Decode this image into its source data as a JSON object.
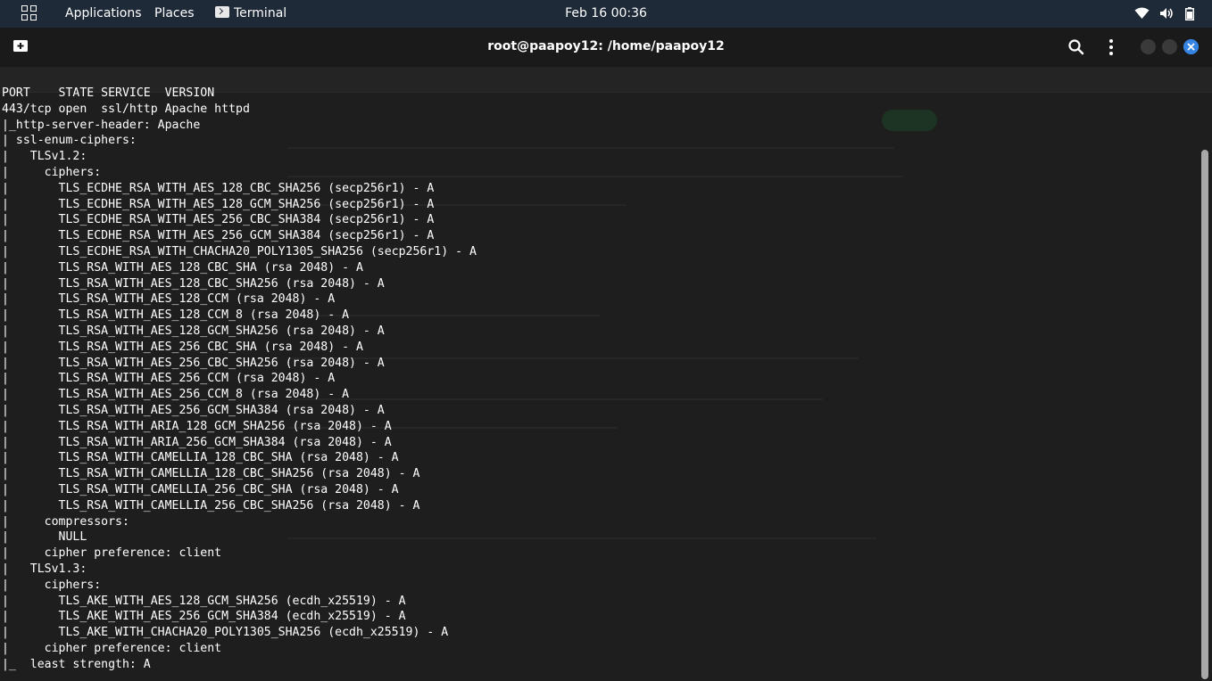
{
  "topbar": {
    "applications": "Applications",
    "places": "Places",
    "terminal": "Terminal",
    "datetime": "Feb 16  00:36"
  },
  "window": {
    "title": "root@paapoy12: /home/paapoy12"
  },
  "terminal": {
    "lines": [
      "PORT    STATE SERVICE  VERSION",
      "443/tcp open  ssl/http Apache httpd",
      "|_http-server-header: Apache",
      "| ssl-enum-ciphers:",
      "|   TLSv1.2:",
      "|     ciphers:",
      "|       TLS_ECDHE_RSA_WITH_AES_128_CBC_SHA256 (secp256r1) - A",
      "|       TLS_ECDHE_RSA_WITH_AES_128_GCM_SHA256 (secp256r1) - A",
      "|       TLS_ECDHE_RSA_WITH_AES_256_CBC_SHA384 (secp256r1) - A",
      "|       TLS_ECDHE_RSA_WITH_AES_256_GCM_SHA384 (secp256r1) - A",
      "|       TLS_ECDHE_RSA_WITH_CHACHA20_POLY1305_SHA256 (secp256r1) - A",
      "|       TLS_RSA_WITH_AES_128_CBC_SHA (rsa 2048) - A",
      "|       TLS_RSA_WITH_AES_128_CBC_SHA256 (rsa 2048) - A",
      "|       TLS_RSA_WITH_AES_128_CCM (rsa 2048) - A",
      "|       TLS_RSA_WITH_AES_128_CCM_8 (rsa 2048) - A",
      "|       TLS_RSA_WITH_AES_128_GCM_SHA256 (rsa 2048) - A",
      "|       TLS_RSA_WITH_AES_256_CBC_SHA (rsa 2048) - A",
      "|       TLS_RSA_WITH_AES_256_CBC_SHA256 (rsa 2048) - A",
      "|       TLS_RSA_WITH_AES_256_CCM (rsa 2048) - A",
      "|       TLS_RSA_WITH_AES_256_CCM_8 (rsa 2048) - A",
      "|       TLS_RSA_WITH_AES_256_GCM_SHA384 (rsa 2048) - A",
      "|       TLS_RSA_WITH_ARIA_128_GCM_SHA256 (rsa 2048) - A",
      "|       TLS_RSA_WITH_ARIA_256_GCM_SHA384 (rsa 2048) - A",
      "|       TLS_RSA_WITH_CAMELLIA_128_CBC_SHA (rsa 2048) - A",
      "|       TLS_RSA_WITH_CAMELLIA_128_CBC_SHA256 (rsa 2048) - A",
      "|       TLS_RSA_WITH_CAMELLIA_256_CBC_SHA (rsa 2048) - A",
      "|       TLS_RSA_WITH_CAMELLIA_256_CBC_SHA256 (rsa 2048) - A",
      "|     compressors:",
      "|       NULL",
      "|     cipher preference: client",
      "|   TLSv1.3:",
      "|     ciphers:",
      "|       TLS_AKE_WITH_AES_128_GCM_SHA256 (ecdh_x25519) - A",
      "|       TLS_AKE_WITH_AES_256_GCM_SHA384 (ecdh_x25519) - A",
      "|       TLS_AKE_WITH_CHACHA20_POLY1305_SHA256 (ecdh_x25519) - A",
      "|     cipher preference: client",
      "|_  least strength: A"
    ]
  },
  "icons": {
    "apps": "apps-grid-icon",
    "terminal": "terminal-icon",
    "wifi": "wifi-icon",
    "volume": "volume-icon",
    "battery": "battery-icon",
    "new_tab": "new-tab-icon",
    "search": "search-icon",
    "menu": "kebab-menu-icon",
    "minimize": "minimize-icon",
    "maximize": "maximize-icon",
    "close": "close-icon"
  },
  "colors": {
    "topbar": "#1f2a38",
    "header": "#1a1a1a",
    "background": "#1c1c1c",
    "text": "#ffffff",
    "close_button": "#3584e4"
  }
}
